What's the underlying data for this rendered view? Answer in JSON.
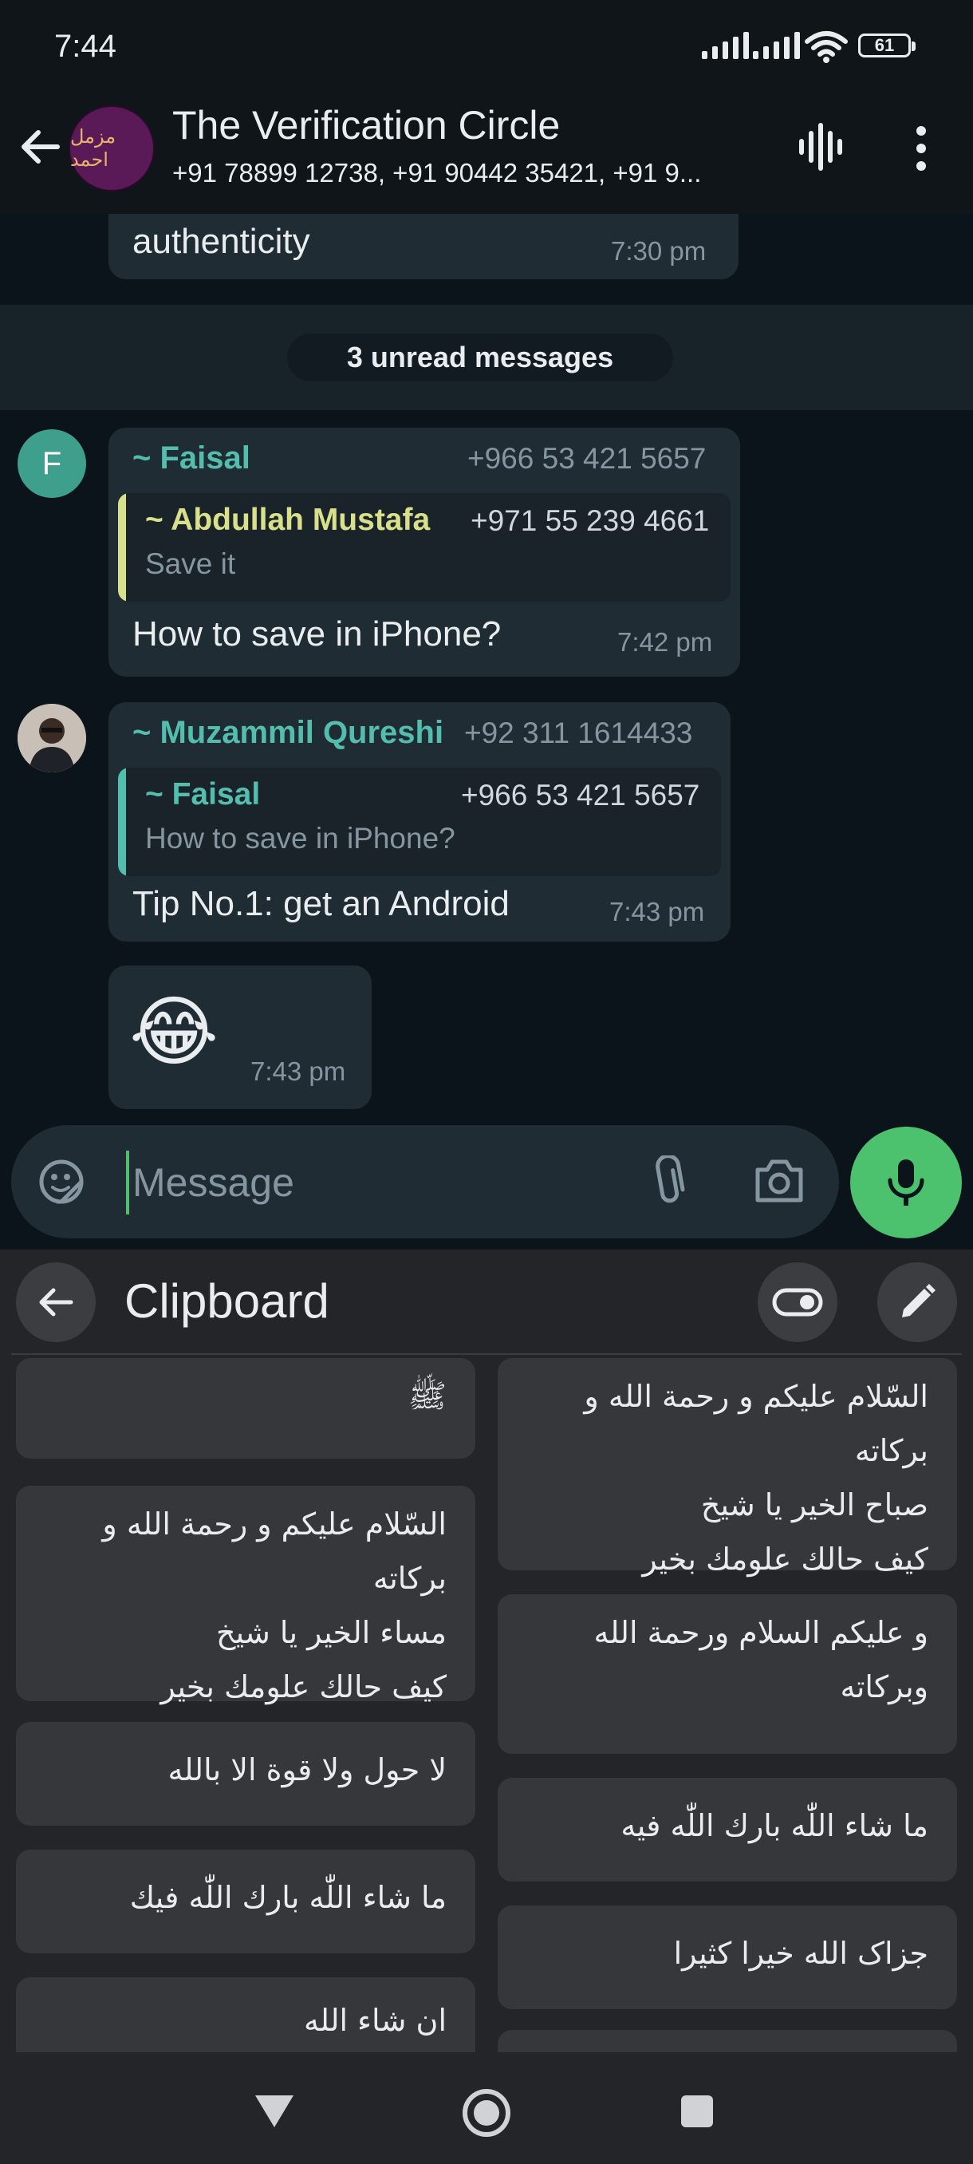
{
  "status_bar": {
    "time": "7:44",
    "battery": "61"
  },
  "header": {
    "title": "The Verification Circle",
    "subtitle": "+91 78899 12738, +91 90442 35421, +91 9...",
    "avatar_text": "مزمل احمد"
  },
  "messages": {
    "prev": {
      "text": "authenticity",
      "time": "7:30 pm"
    },
    "unread_label": "3 unread messages",
    "m1": {
      "avatar_letter": "F",
      "sender": "~ Faisal",
      "phone": "+966 53 421 5657",
      "quote_name": "~ Abdullah Mustafa",
      "quote_phone": "+971 55 239 4661",
      "quote_text": "Save it",
      "text": "How to save in iPhone?",
      "time": "7:42 pm"
    },
    "m2": {
      "sender": "~ Muzammil Qureshi",
      "phone": "+92 311 1614433",
      "quote_name": "~ Faisal",
      "quote_phone": "+966 53 421 5657",
      "quote_text": "How to save in iPhone?",
      "text": "Tip No.1: get an Android",
      "time": "7:43 pm"
    },
    "m3": {
      "text": "😂",
      "time": "7:43 pm"
    }
  },
  "composer": {
    "placeholder": "Message"
  },
  "clipboard": {
    "title": "Clipboard",
    "left": [
      "ﷺ",
      "السّلام عليكم و رحمة الله و بركاته\nمساء الخير يا شيخ\nكيف حالك علومك بخير",
      "لا حول ولا قوة الا بالله",
      "ما شاء اللّٰه بارك اللّٰه فيك",
      "ان شاء الله"
    ],
    "right": [
      "السّلام عليكم و رحمة الله و بركاته\nصباح الخير يا شيخ\nكيف حالك علومك بخير",
      "و عليكم السلام ورحمة الله\nوبركاته",
      "ما شاء اللّٰه بارك اللّٰه فيه",
      "جزاک الله خيرا كثيرا",
      ""
    ]
  },
  "colors": {
    "accent_green": "#4cc26f",
    "sender_teal": "#53bdae",
    "quote_yellow": "#d9e08b"
  },
  "icons": [
    "back-arrow-icon",
    "voice-chat-icon",
    "more-vert-icon",
    "sticker-icon",
    "attach-icon",
    "camera-icon",
    "mic-icon",
    "clipboard-back-icon",
    "toggle-icon",
    "edit-pencil-icon",
    "nav-back-icon",
    "nav-home-icon",
    "nav-recents-icon"
  ]
}
